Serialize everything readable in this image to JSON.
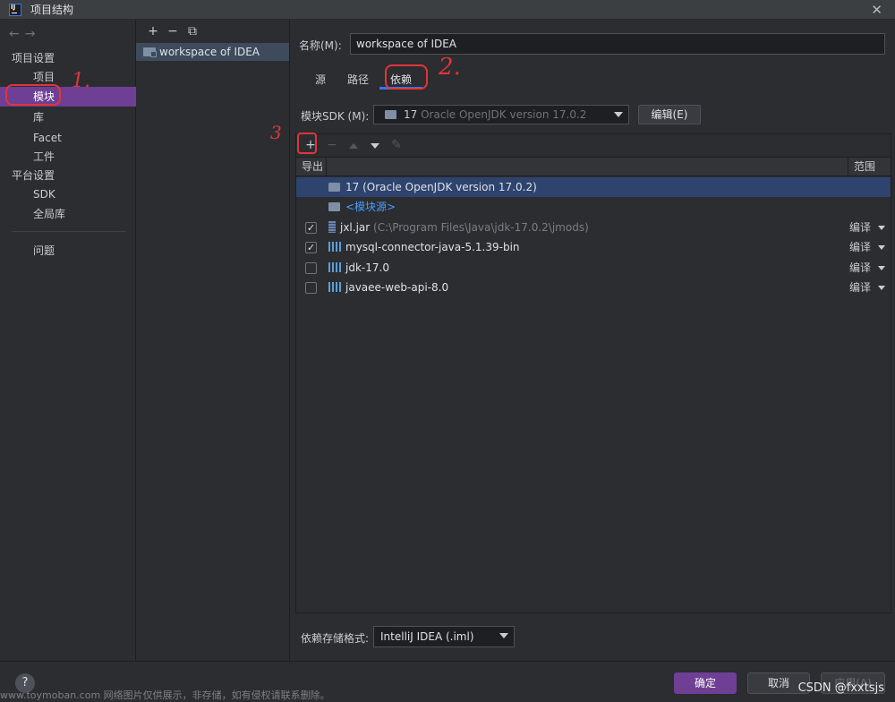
{
  "window": {
    "title": "项目结构",
    "close_glyph": "✕"
  },
  "nav": {
    "back_glyph": "←",
    "forward_glyph": "→"
  },
  "sidebar": {
    "groups": [
      {
        "label": "项目设置",
        "items": [
          "项目",
          "模块",
          "库",
          "Facet",
          "工件"
        ]
      },
      {
        "label": "平台设置",
        "items": [
          "SDK",
          "全局库"
        ]
      }
    ],
    "problems_label": "问题",
    "selected": "模块"
  },
  "modules": {
    "tools": [
      "+",
      "−",
      "⧉"
    ],
    "items": [
      "workspace of IDEA"
    ]
  },
  "main": {
    "name_label": "名称(M):",
    "name_value": "workspace of IDEA",
    "tabs": [
      "源",
      "路径",
      "依赖"
    ],
    "active_tab": "依赖",
    "sdk_label": "模块SDK (M):",
    "sdk_version": "17",
    "sdk_detail": "Oracle OpenJDK version 17.0.2",
    "edit_button": "编辑(E)",
    "toolbar": {
      "add": "+",
      "remove": "−",
      "edit": "✎"
    },
    "table_headers": {
      "export": "导出",
      "scope": "范围"
    },
    "rows": [
      {
        "name": "17 (Oracle OpenJDK version 17.0.2)",
        "type": "sdk"
      },
      {
        "name": "<模块源>",
        "type": "module-source"
      },
      {
        "name": "jxl.jar",
        "path": "(C:\\Program Files\\Java\\jdk-17.0.2\\jmods)",
        "type": "jar",
        "checked": true,
        "scope": "编译"
      },
      {
        "name": "mysql-connector-java-5.1.39-bin",
        "type": "library",
        "checked": true,
        "scope": "编译"
      },
      {
        "name": "jdk-17.0",
        "type": "library",
        "checked": false,
        "scope": "编译"
      },
      {
        "name": "javaee-web-api-8.0",
        "type": "library",
        "checked": false,
        "scope": "编译"
      }
    ],
    "format_label": "依赖存储格式:",
    "format_value": "IntelliJ IDEA (.iml)"
  },
  "footer": {
    "help": "?",
    "ok": "确定",
    "cancel": "取消",
    "apply": "应用(A)",
    "watermark": "www.toymoban.com 网络图片仅供展示，非存储，如有侵权请联系删除。",
    "csdn": "CSDN @fxxtsjs"
  },
  "annotations": {
    "one": "1.",
    "two": "2.",
    "three": "3"
  },
  "colors": {
    "accent_purple": "#6e3f94",
    "accent_blue": "#3574f0",
    "annotation_red": "#e0353a"
  }
}
